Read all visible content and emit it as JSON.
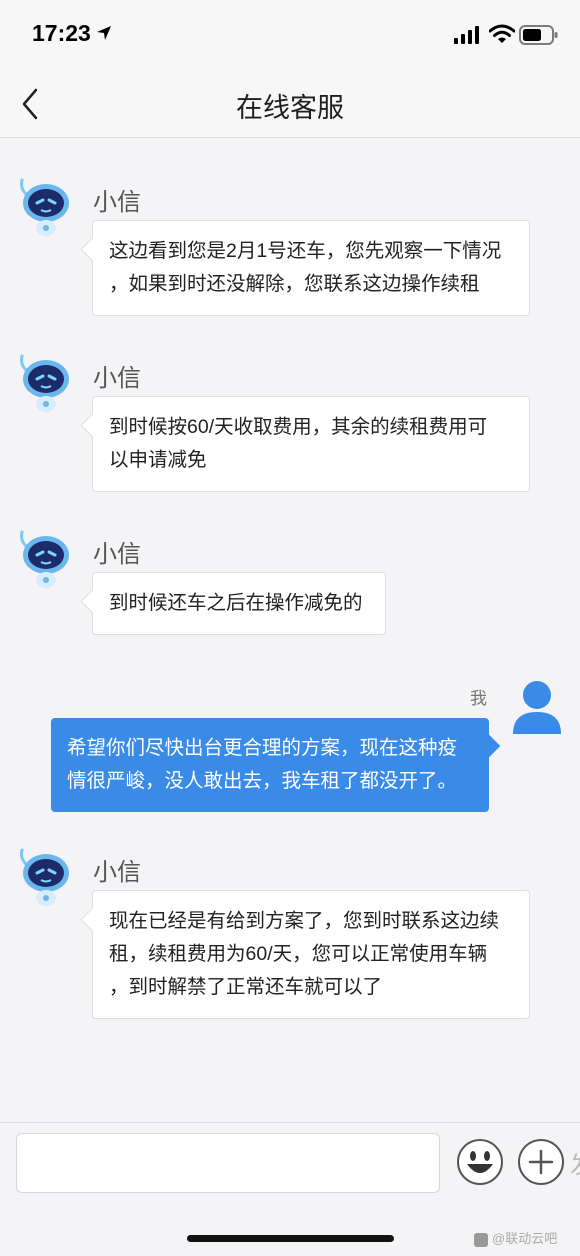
{
  "status_bar": {
    "time": "17:23",
    "icons": [
      "location-arrow-icon",
      "signal-bars-icon",
      "wifi-icon",
      "battery-icon"
    ]
  },
  "nav": {
    "title": "在线客服",
    "back_icon": "chevron-left-icon"
  },
  "messages": [
    {
      "side": "left",
      "sender": "小信",
      "lines": [
        "这边看到您是2月1号还车，您先观察一下情况",
        "，如果到时还没解除，您联系这边操作续租"
      ]
    },
    {
      "side": "left",
      "sender": "小信",
      "lines": [
        "到时候按60/天收取费用，其余的续租费用可",
        "以申请减免"
      ]
    },
    {
      "side": "left",
      "sender": "小信",
      "lines": [
        "到时候还车之后在操作减免的"
      ]
    },
    {
      "side": "right",
      "sender": "我",
      "lines": [
        "希望你们尽快出台更合理的方案，现在这种疫",
        "情很严峻，没人敢出去，我车租了都没开了。"
      ]
    },
    {
      "side": "left",
      "sender": "小信",
      "lines": [
        "现在已经是有给到方案了，您到时联系这边续",
        "租，续租费用为60/天，您可以正常使用车辆",
        "，到时解禁了正常还车就可以了"
      ]
    }
  ],
  "input_bar": {
    "placeholder": "",
    "send_label_partial": "发",
    "emoji_icon": "smiley-face-icon",
    "add_icon": "plus-circle-icon"
  },
  "watermark": "@联动云吧",
  "colors": {
    "accent_blue": "#3a8be8",
    "background": "#f4f4f6",
    "bubble_white": "#ffffff"
  }
}
